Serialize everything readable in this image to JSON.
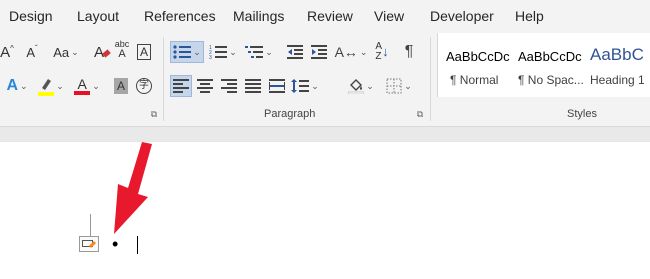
{
  "menu": {
    "tabs": [
      "Design",
      "Layout",
      "References",
      "Mailings",
      "Review",
      "View",
      "Developer",
      "Help"
    ]
  },
  "ribbon": {
    "font_row1": {
      "font_grow": "A",
      "font_shrink": "A",
      "change_case": "Aa",
      "clear_formatting": "A",
      "text_effects": "abc"
    },
    "font_row2": {
      "text_highlight_color": "#ffff00",
      "font_color_swatch": "#e81123",
      "character_shading": "A"
    },
    "paragraph_label": "Paragraph",
    "styles_label": "Styles",
    "styles": [
      {
        "sample": "AaBbCcDc",
        "name": "¶ Normal"
      },
      {
        "sample": "AaBbCcDc",
        "name": "¶ No Spac..."
      },
      {
        "sample": "AaBbC",
        "name": "Heading 1"
      }
    ]
  },
  "document": {
    "bullet": "•"
  },
  "colors": {
    "accent_blue": "#2b579a",
    "arrow_red": "#e8192c",
    "selected_button": "#c5d5ea"
  }
}
